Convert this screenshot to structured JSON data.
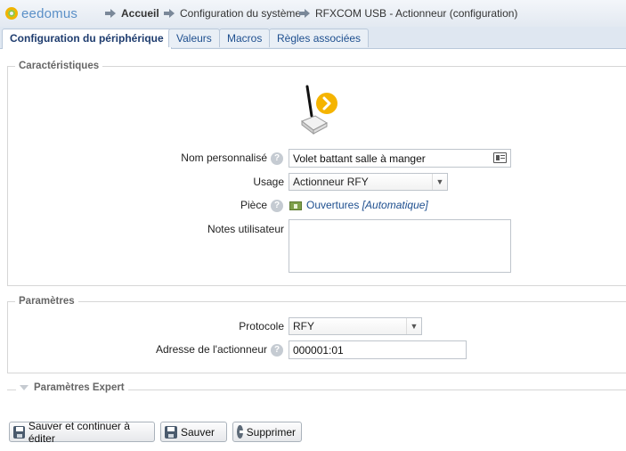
{
  "header": {
    "logo_text": "eedomus",
    "breadcrumb": [
      "Accueil",
      "Configuration du système",
      "RFXCOM USB - Actionneur (configuration)"
    ]
  },
  "tabs": [
    {
      "label": "Configuration du périphérique",
      "active": true
    },
    {
      "label": "Valeurs",
      "active": false
    },
    {
      "label": "Macros",
      "active": false
    },
    {
      "label": "Règles associées",
      "active": false
    }
  ],
  "characteristics": {
    "legend": "Caractéristiques",
    "device_icon": "rf-actuator-icon",
    "name_label": "Nom personnalisé",
    "name_value": "Volet battant salle à manger",
    "usage_label": "Usage",
    "usage_value": "Actionneur RFY",
    "room_label": "Pièce",
    "room_value": "Ouvertures",
    "room_auto": "[Automatique]",
    "notes_label": "Notes utilisateur",
    "notes_value": ""
  },
  "parameters": {
    "legend": "Paramètres",
    "protocol_label": "Protocole",
    "protocol_value": "RFY",
    "address_label": "Adresse de l'actionneur",
    "address_value": "000001:01"
  },
  "expert": {
    "legend": "Paramètres Expert"
  },
  "actions": {
    "save_continue": "Sauver et continuer à éditer",
    "save": "Sauver",
    "delete": "Supprimer"
  },
  "help_glyph": "?",
  "colors": {
    "accent": "#1e4f8f",
    "logo_orange": "#f0b400",
    "logo_green": "#8cc63f",
    "arrow_badge": "#f5b400"
  }
}
